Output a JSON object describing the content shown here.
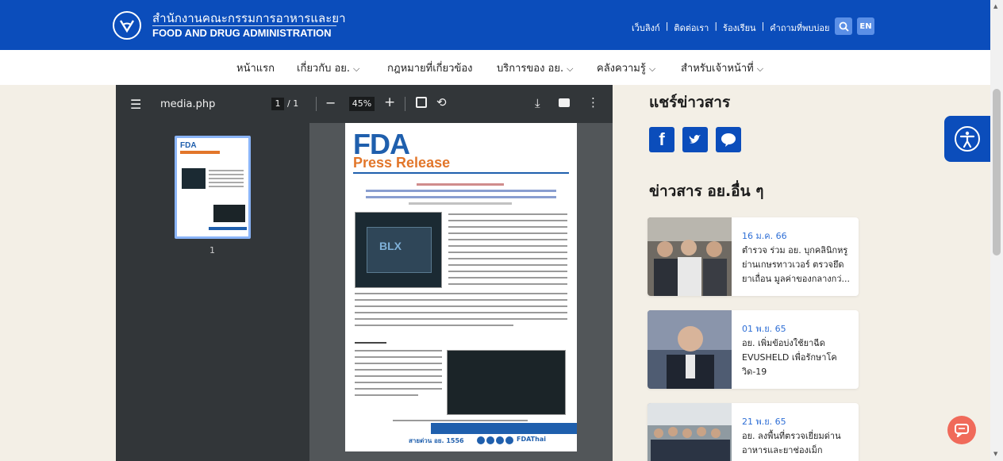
{
  "header": {
    "title_th": "สำนักงานคณะกรรมการอาหารและยา",
    "title_en": "FOOD AND DRUG ADMINISTRATION",
    "links": [
      "เว็บลิงก์",
      "ติดต่อเรา",
      "ร้องเรียน",
      "คำถามที่พบบ่อย"
    ],
    "lang_label": "EN",
    "brand_color": "#0b4dbb"
  },
  "nav": {
    "items": [
      {
        "label": "หน้าแรก",
        "dropdown": false
      },
      {
        "label": "เกี่ยวกับ อย.",
        "dropdown": true
      },
      {
        "label": "กฎหมายที่เกี่ยวข้อง",
        "dropdown": false
      },
      {
        "label": "บริการของ อย.",
        "dropdown": true
      },
      {
        "label": "คลังความรู้",
        "dropdown": true
      },
      {
        "label": "สำหรับเจ้าหน้าที่",
        "dropdown": true
      }
    ]
  },
  "pdf_viewer": {
    "file_name": "media.php",
    "current_page": "1",
    "page_total": "/ 1",
    "zoom": "45%",
    "thumbnail_label": "1",
    "page": {
      "logo": "FDA",
      "logo_sub": "Press Release",
      "footer_text": "สายด่วน อย. 1556",
      "footer_social": "FDAThai"
    }
  },
  "share": {
    "title": "แชร์ข่าวสาร",
    "buttons": [
      "facebook-icon",
      "twitter-icon",
      "line-icon"
    ]
  },
  "news": {
    "title": "ข่าวสาร อย.อื่น ๆ",
    "items": [
      {
        "date": "16 ม.ค. 66",
        "text": "ตำรวจ ร่วม อย. บุกคลินิกหรู ย่านเกษรทาวเวอร์ ตรวจยึด ยาเถื่อน มูลค่าของกลางกว่..."
      },
      {
        "date": "01 พ.ย. 65",
        "text": "อย. เพิ่มข้อบ่งใช้ยาฉีด EVUSHELD เพื่อรักษาโค วิด-19"
      },
      {
        "date": "21 พ.ย. 65",
        "text": "อย. ลงพื้นที่ตรวจเยี่ยมด่าน อาหารและยาช่องเม็ก"
      }
    ]
  }
}
